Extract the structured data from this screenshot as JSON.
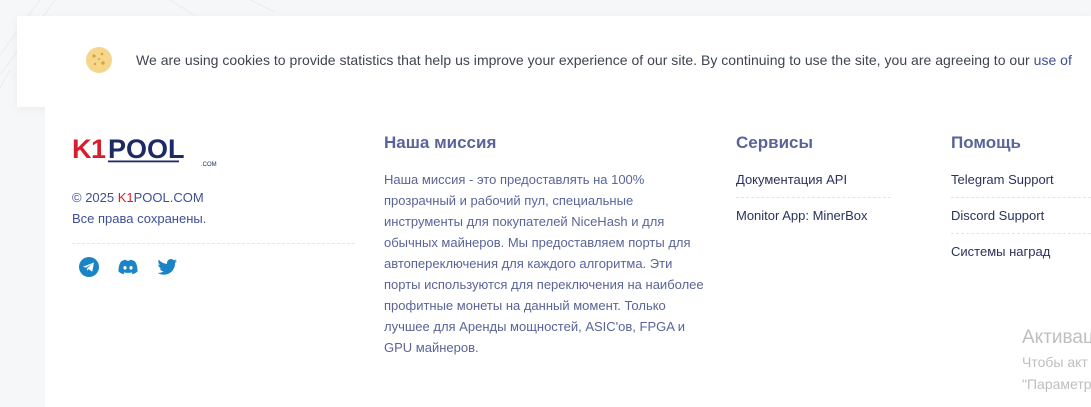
{
  "cookie_banner": {
    "text": "We are using cookies to provide statistics that help us improve your experience of our site. By continuing to use the site, you are agreeing to our ",
    "link_text": "use of"
  },
  "footer": {
    "logo_alt": "K1POOL.COM",
    "copyright_prefix": "© 2025 ",
    "brand_k1": "K1",
    "brand_rest": "POOL.COM",
    "rights": "Все права сохранены.",
    "mission": {
      "title": "Наша миссия",
      "text": "Наша миссия - это предоставлять на 100% прозрачный и рабочий пул, специальные инструменты для покупателей NiceHash и для обычных майнеров. Мы предоставляем порты для автопереключения для каждого алгоритма. Эти порты используются для переключения на наиболее профитные монеты на данный момент. Только лучшее для Аренды мощностей, ASIC'ов, FPGA и GPU майнеров."
    },
    "services": {
      "title": "Сервисы",
      "items": [
        "Документация API",
        "Monitor App: MinerBox"
      ]
    },
    "help": {
      "title": "Помощь",
      "items": [
        "Telegram Support",
        "Discord Support",
        "Системы наград"
      ]
    }
  },
  "overlay": {
    "line1": "Активац",
    "line2": "Чтобы акт",
    "line3": "\"Параметр"
  },
  "colors": {
    "brand_blue": "#1d2a66",
    "brand_red": "#d81e2c",
    "link_blue": "#3e4f97",
    "social_blue": "#1b84c6"
  }
}
